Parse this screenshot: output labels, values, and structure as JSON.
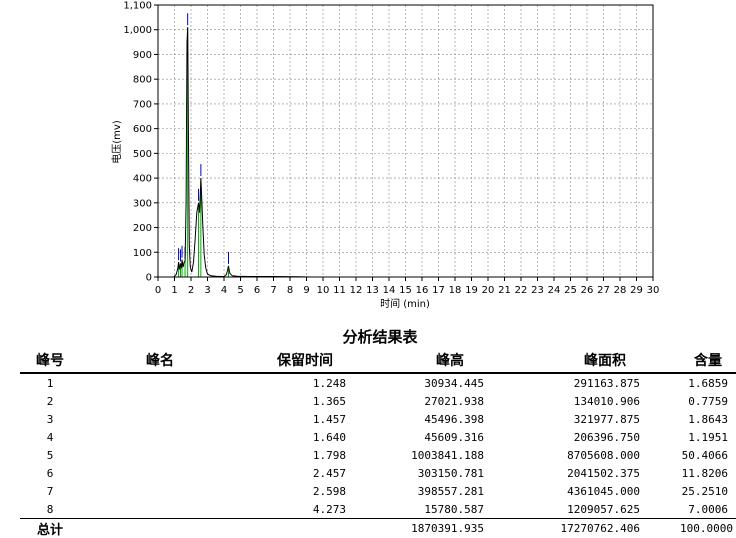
{
  "chart_data": {
    "type": "line",
    "title": "",
    "xlabel": "时间 (min)",
    "ylabel": "电压(mv)",
    "xlim": [
      0,
      30
    ],
    "ylim": [
      0,
      1100
    ],
    "x_ticks": [
      0,
      1,
      2,
      3,
      4,
      5,
      6,
      7,
      8,
      9,
      10,
      11,
      12,
      13,
      14,
      15,
      16,
      17,
      18,
      19,
      20,
      21,
      22,
      23,
      24,
      25,
      26,
      27,
      28,
      29,
      30
    ],
    "y_ticks": [
      0,
      100,
      200,
      300,
      400,
      500,
      600,
      700,
      800,
      900,
      1000,
      1100
    ],
    "y_tick_labels": [
      "0",
      "100",
      "200",
      "300",
      "400",
      "500",
      "600",
      "700",
      "800",
      "900",
      "1,000",
      "1,100"
    ],
    "grid": true,
    "series": [
      {
        "x": [
          0.95,
          1.1,
          1.2,
          1.248,
          1.3,
          1.365,
          1.41,
          1.457,
          1.52,
          1.58,
          1.64,
          1.7,
          1.76,
          1.798,
          1.84,
          1.9,
          1.96,
          2.05,
          2.15,
          2.25,
          2.35,
          2.457,
          2.52,
          2.598,
          2.66,
          2.72,
          2.8,
          2.9,
          3.0,
          3.2,
          3.5,
          3.8,
          4.0,
          4.15,
          4.273,
          4.35,
          4.5,
          4.8,
          5.5,
          7.0,
          8.5,
          9.3
        ],
        "y": [
          0,
          10,
          35,
          60,
          30,
          55,
          35,
          70,
          40,
          60,
          65,
          300,
          950,
          1010,
          600,
          130,
          40,
          20,
          60,
          150,
          260,
          300,
          260,
          400,
          300,
          200,
          90,
          35,
          12,
          5,
          3,
          2,
          2,
          10,
          45,
          15,
          5,
          3,
          2,
          2,
          1,
          0
        ]
      }
    ],
    "peak_markers": [
      1.248,
      1.365,
      1.457,
      1.64,
      1.798,
      2.457,
      2.598,
      4.273
    ]
  },
  "report": {
    "title": "分析结果表",
    "headers": [
      "峰号",
      "峰名",
      "保留时间",
      "峰高",
      "峰面积",
      "含量"
    ],
    "rows": [
      [
        "1",
        "",
        "1.248",
        "30934.445",
        "291163.875",
        "1.6859"
      ],
      [
        "2",
        "",
        "1.365",
        "27021.938",
        "134010.906",
        "0.7759"
      ],
      [
        "3",
        "",
        "1.457",
        "45496.398",
        "321977.875",
        "1.8643"
      ],
      [
        "4",
        "",
        "1.640",
        "45609.316",
        "206396.750",
        "1.1951"
      ],
      [
        "5",
        "",
        "1.798",
        "1003841.188",
        "8705608.000",
        "50.4066"
      ],
      [
        "6",
        "",
        "2.457",
        "303150.781",
        "2041502.375",
        "11.8206"
      ],
      [
        "7",
        "",
        "2.598",
        "398557.281",
        "4361045.000",
        "25.2510"
      ],
      [
        "8",
        "",
        "4.273",
        "15780.587",
        "1209057.625",
        "7.0006"
      ]
    ],
    "total": [
      "总计",
      "",
      "",
      "1870391.935",
      "17270762.406",
      "100.0000"
    ]
  },
  "colors": {
    "trace": "#000000",
    "marker": "#0000cc",
    "baseline": "#00aa00",
    "grid": "#888888"
  }
}
